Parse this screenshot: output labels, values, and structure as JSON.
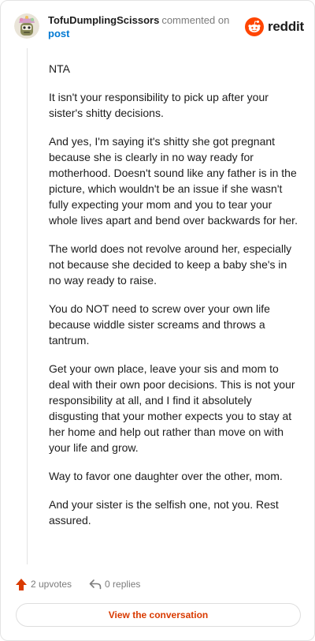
{
  "header": {
    "username": "TofuDumplingScissors",
    "action_text": "commented on",
    "target_link": "post",
    "brand_name": "reddit",
    "brand_color": "#ff4500"
  },
  "comment": {
    "paragraphs": [
      "NTA",
      "It isn't your responsibility to pick up after your sister's shitty decisions.",
      "And yes, I'm saying it's shitty she got pregnant because she is clearly in no way ready for motherhood. Doesn't sound like any father is in the picture, which wouldn't be an issue if she wasn't fully expecting your mom and you to tear your whole lives apart and bend over backwards for her.",
      "The world does not revolve around her, especially not because she decided to keep a baby she's in no way ready to raise.",
      "You do NOT need to screw over your own life because widdle sister screams and throws a tantrum.",
      "Get your own place, leave your sis and mom to deal with their own poor decisions. This is not your responsibility at all, and I find it absolutely disgusting that your mother expects you to stay at her home and help out rather than move on with your life and grow.",
      "Way to favor one daughter over the other, mom.",
      "And your sister is the selfish one, not you. Rest assured."
    ]
  },
  "footer": {
    "upvotes_label": "2 upvotes",
    "replies_label": "0 replies",
    "view_conversation_label": "View the conversation",
    "upvote_color": "#d93a00"
  }
}
